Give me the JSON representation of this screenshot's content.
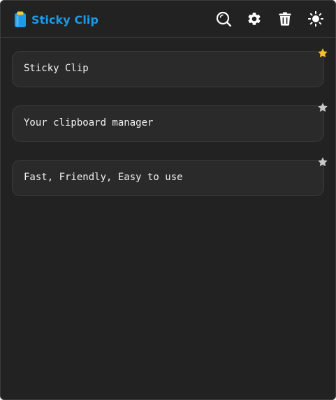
{
  "app": {
    "title": "Sticky Clip",
    "title_color": "#1e9ae6",
    "logo_icon": "clipboard-icon"
  },
  "toolbar": {
    "buttons": [
      {
        "name": "search-button",
        "icon": "search-icon"
      },
      {
        "name": "settings-button",
        "icon": "gear-icon"
      },
      {
        "name": "clear-button",
        "icon": "trash-icon"
      },
      {
        "name": "theme-toggle-button",
        "icon": "sun-icon"
      }
    ]
  },
  "clips": [
    {
      "text": "Sticky Clip",
      "starred": true
    },
    {
      "text": "Your clipboard manager",
      "starred": false
    },
    {
      "text": "Fast, Friendly, Easy to use",
      "starred": false
    }
  ],
  "colors": {
    "background": "#222222",
    "card": "#2a2a2a",
    "star_active": "#f5bf2a",
    "star_inactive": "#c8c8c8"
  }
}
